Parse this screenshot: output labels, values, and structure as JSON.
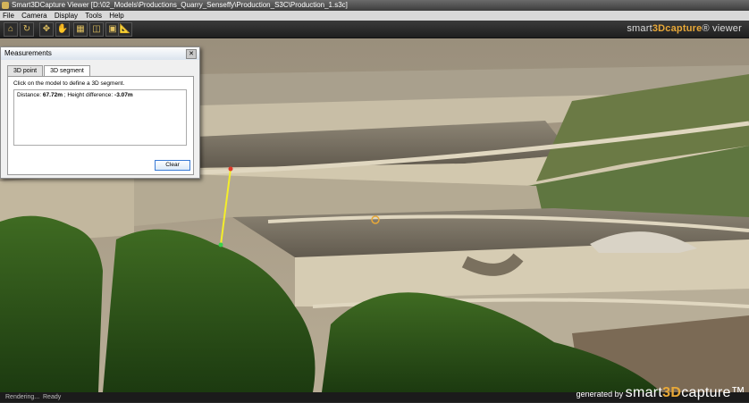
{
  "window": {
    "title": "Smart3DCapture Viewer [D:\\02_Models\\Productions_Quarry_Senseffy\\Production_S3C\\Production_1.s3c]"
  },
  "menu": {
    "items": [
      "File",
      "Camera",
      "Display",
      "Tools",
      "Help"
    ]
  },
  "toolbar": {
    "brand_prefix": "smart",
    "brand_mid": "3D",
    "brand_bold": "capture",
    "brand_suffix": "® viewer"
  },
  "measurements": {
    "title": "Measurements",
    "close": "✕",
    "tabs": [
      "3D point",
      "3D segment"
    ],
    "active_tab": "3D segment",
    "instruction": "Click on the model to define a 3D segment.",
    "distance_label": "Distance:",
    "distance_value": "67.72m",
    "sep": "; Height difference:",
    "height_value": "-3.07m",
    "clear_label": "Clear"
  },
  "status": {
    "left": "Rendering...",
    "right": "Ready"
  },
  "footer": {
    "generated_by": "generated by",
    "brand_prefix": "smart",
    "brand_mid": "3D",
    "brand_bold": "capture",
    "brand_tm": "™"
  },
  "colors": {
    "accent": "#e8a838",
    "measure_line": "#f4ee2a"
  }
}
